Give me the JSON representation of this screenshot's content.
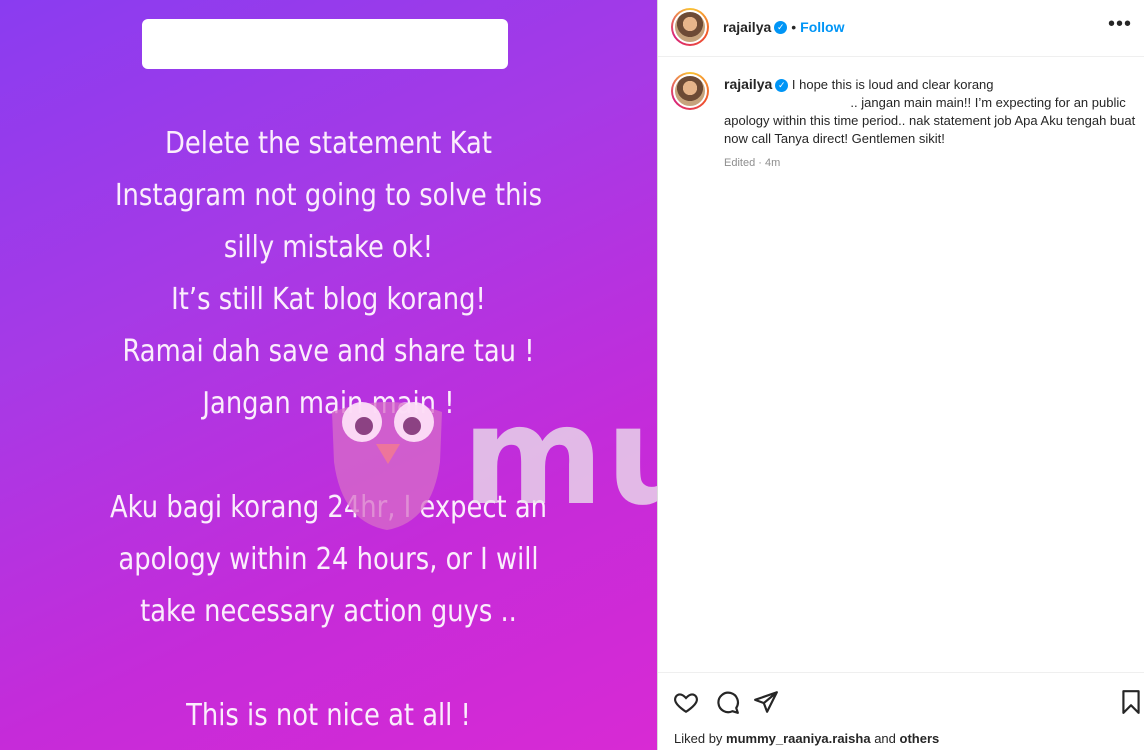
{
  "story": {
    "lines": [
      "Delete the statement Kat",
      "Instagram not going to solve this",
      "silly mistake ok!",
      "It’s still Kat blog korang!",
      "Ramai dah save and share tau !",
      "Jangan main main !",
      "",
      "Aku bagi korang 24hr, I expect an",
      "apology within 24 hours, or I will",
      "take necessary action guys ..",
      "",
      "This is not nice at all !"
    ],
    "watermark": "murai"
  },
  "post": {
    "username": "rajailya",
    "follow_label": "Follow",
    "more_icon": "more-options-icon",
    "caption_text": "I hope this is loud and clear korang\n                                   .. jangan main main!! I’m expecting for an public apology within this time period.. nak statement job Apa Aku tengah buat now call Tanya direct! Gentlemen sikit!",
    "edited": "Edited · 4m",
    "liked_by_prefix": "Liked by",
    "liked_by_user": "mummy_raaniya.raisha",
    "liked_by_and": "and",
    "liked_by_others": "others"
  },
  "icons": {
    "like": "heart-icon",
    "comment": "comment-icon",
    "share": "share-icon",
    "save": "bookmark-icon"
  },
  "colors": {
    "accent": "#0095f6",
    "story_gradient_start": "#8a3cf0",
    "story_gradient_end": "#d82ad4"
  }
}
